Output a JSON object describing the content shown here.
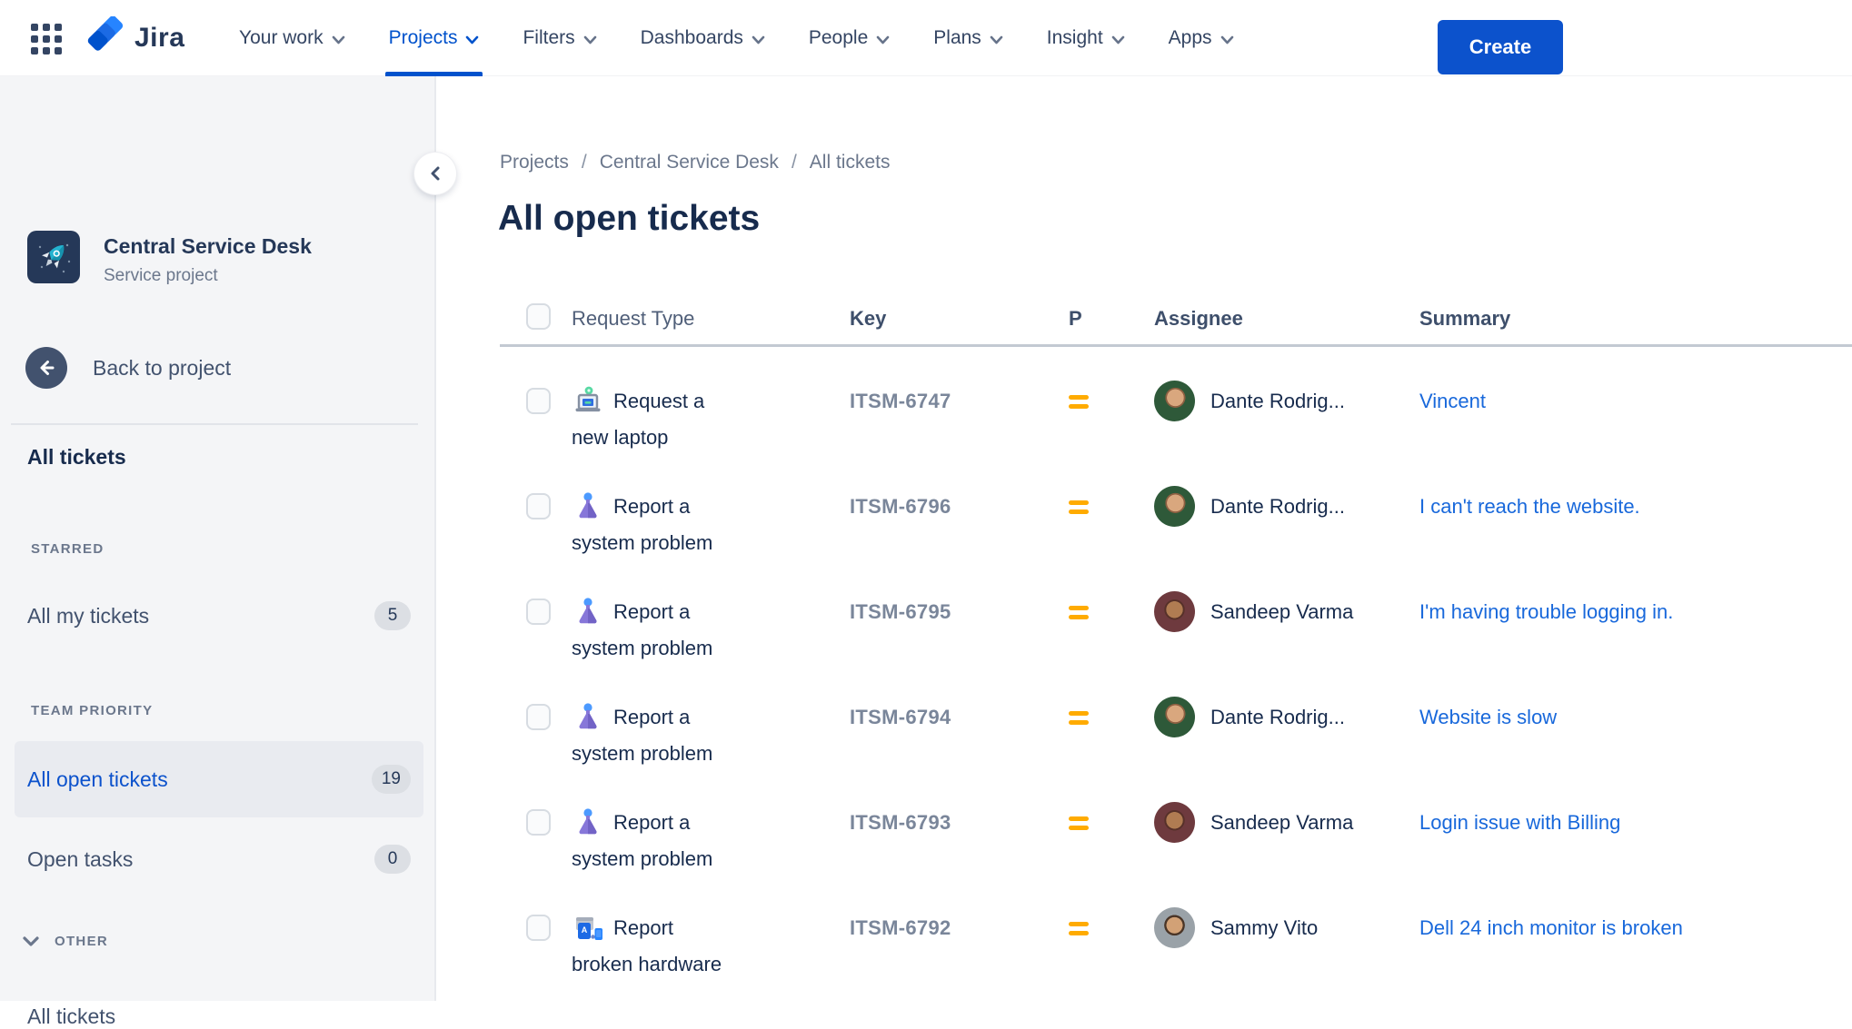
{
  "nav": {
    "logo_text": "Jira",
    "items": [
      {
        "label": "Your work",
        "active": false
      },
      {
        "label": "Projects",
        "active": true
      },
      {
        "label": "Filters",
        "active": false
      },
      {
        "label": "Dashboards",
        "active": false
      },
      {
        "label": "People",
        "active": false
      },
      {
        "label": "Plans",
        "active": false
      },
      {
        "label": "Insight",
        "active": false
      },
      {
        "label": "Apps",
        "active": false
      }
    ],
    "create_label": "Create"
  },
  "sidebar": {
    "project": {
      "name": "Central Service Desk",
      "type": "Service project"
    },
    "back_label": "Back to project",
    "all_tickets_label": "All tickets",
    "sections": [
      {
        "heading": "STARRED",
        "items": [
          {
            "label": "All my tickets",
            "badge": "5",
            "selected": false
          }
        ]
      },
      {
        "heading": "TEAM PRIORITY",
        "items": [
          {
            "label": "All open tickets",
            "badge": "19",
            "selected": true
          },
          {
            "label": "Open tasks",
            "badge": "0",
            "selected": false
          }
        ]
      }
    ],
    "other": {
      "heading": "OTHER",
      "items": [
        {
          "label": "All tickets"
        }
      ]
    }
  },
  "main": {
    "breadcrumb": {
      "crumbs": [
        "Projects",
        "Central Service Desk",
        "All tickets"
      ],
      "separator": "/"
    },
    "title": "All open tickets",
    "table": {
      "columns": [
        "Request Type",
        "Key",
        "P",
        "Assignee",
        "Summary"
      ],
      "rows": [
        {
          "request_type": "Request a new laptop",
          "icon": "laptop-request-icon",
          "key": "ITSM-6747",
          "priority": "Medium",
          "assignee": "Dante Rodrig...",
          "avatar": "dante",
          "summary": "Vincent"
        },
        {
          "request_type": "Report a system problem",
          "icon": "system-problem-icon",
          "key": "ITSM-6796",
          "priority": "Medium",
          "assignee": "Dante Rodrig...",
          "avatar": "dante",
          "summary": "I can't reach the website."
        },
        {
          "request_type": "Report a system problem",
          "icon": "system-problem-icon",
          "key": "ITSM-6795",
          "priority": "Medium",
          "assignee": "Sandeep Varma",
          "avatar": "sandeep",
          "summary": "I'm having trouble logging in."
        },
        {
          "request_type": "Report a system problem",
          "icon": "system-problem-icon",
          "key": "ITSM-6794",
          "priority": "Medium",
          "assignee": "Dante Rodrig...",
          "avatar": "dante",
          "summary": "Website is slow"
        },
        {
          "request_type": "Report a system problem",
          "icon": "system-problem-icon",
          "key": "ITSM-6793",
          "priority": "Medium",
          "assignee": "Sandeep Varma",
          "avatar": "sandeep",
          "summary": "Login issue with Billing"
        },
        {
          "request_type": "Report broken hardware",
          "icon": "hardware-icon",
          "key": "ITSM-6792",
          "priority": "Medium",
          "assignee": "Sammy Vito",
          "avatar": "sammy",
          "summary": "Dell 24 inch monitor is broken"
        }
      ]
    }
  },
  "colors": {
    "brand_blue": "#0052CC",
    "link_blue": "#1868DB",
    "priority_medium": "#FFAB00",
    "sidebar_bg": "#F4F5F7",
    "text_dark": "#172B4D",
    "text_gray": "#6B778C"
  }
}
